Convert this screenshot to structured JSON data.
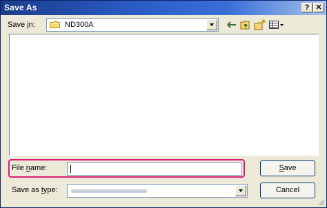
{
  "window": {
    "title": "Save As",
    "help_button": "?",
    "close_button": "✕"
  },
  "toolbar": {
    "save_in_label_pre": "Save ",
    "save_in_label_u": "i",
    "save_in_label_post": "n:",
    "save_in_value": "ND300A",
    "icons": [
      "back-arrow-icon",
      "up-one-level-icon",
      "new-folder-icon",
      "view-menu-icon"
    ]
  },
  "form": {
    "file_name_label_pre": "File ",
    "file_name_label_u": "n",
    "file_name_label_post": "ame:",
    "file_name_value": "",
    "save_as_type_label_pre": "Save as ",
    "save_as_type_label_u": "t",
    "save_as_type_label_post": "ype:"
  },
  "buttons": {
    "save_u": "S",
    "save_rest": "ave",
    "cancel": "Cancel"
  },
  "colors": {
    "title_bar": "#2a5bc4",
    "highlight": "#d81b73",
    "dialog_bg": "#ece9d8"
  }
}
